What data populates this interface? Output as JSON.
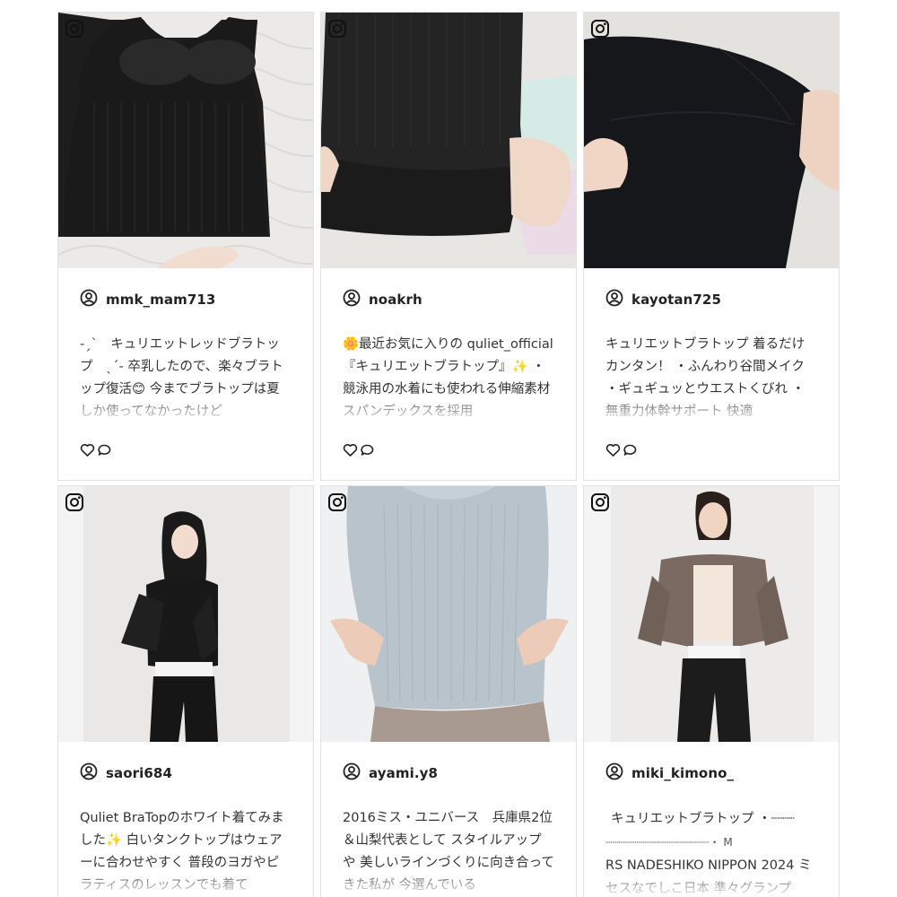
{
  "posts": [
    {
      "username": "mmk_mam713",
      "caption": "-ˏˋ　キュリエットレッドブラトップ　ˎˊ- 卒乳したので、楽々ブラトップ復活😊 今までブラトップは夏しか使ってなかったけど",
      "photo": "black-bra-top-on-bed",
      "source_icon": "instagram-icon"
    },
    {
      "username": "noakrh",
      "caption": "🌼最近お気に入りの quliet_official 『キュリエットブラトップ』✨ ・ 競泳用の水着にも使われる伸縮素材 スパンデックスを採用",
      "photo": "black-top-held-in-hands",
      "source_icon": "instagram-icon"
    },
    {
      "username": "kayotan725",
      "caption": "キュリエットブラトップ 着るだけカンタン！ ・ふんわり谷間メイク ・ギュギュッとウエストくびれ ・無重力体幹サポート 快適",
      "photo": "black-fabric-closeup",
      "source_icon": "instagram-icon"
    },
    {
      "username": "saori684",
      "caption": "Quliet BraTopのホワイト着てみました✨ 白いタンクトップはウェアーに合わせやすく 普段のヨガやピラティスのレッスンでも着て",
      "photo": "woman-black-jacket-white-top",
      "source_icon": "instagram-icon"
    },
    {
      "username": "ayami.y8",
      "caption": "2016ミス・ユニバース　兵庫県2位＆山梨代表として スタイルアップや 美しいラインづくりに向き合ってきた私が 今選んでいる",
      "photo": "grey-ribbed-knit-torso",
      "source_icon": "instagram-icon"
    },
    {
      "username": "miki_kimono_",
      "caption_lines": [
        "キュリエットブラトップ ・┈┈┈",
        "┈┈┈┈┈┈┈┈┈┈┈┈┈┈┈┈・ M",
        "RS NADESHIKO NIPPON 2024 ミセスなでしこ日本 準々グランプ"
      ],
      "photo": "woman-brown-hoodie-black-jeans",
      "source_icon": "instagram-icon"
    }
  ],
  "icons": {
    "source": "instagram-icon",
    "user": "user-circle-icon",
    "like": "heart-icon",
    "comment": "comment-icon"
  }
}
